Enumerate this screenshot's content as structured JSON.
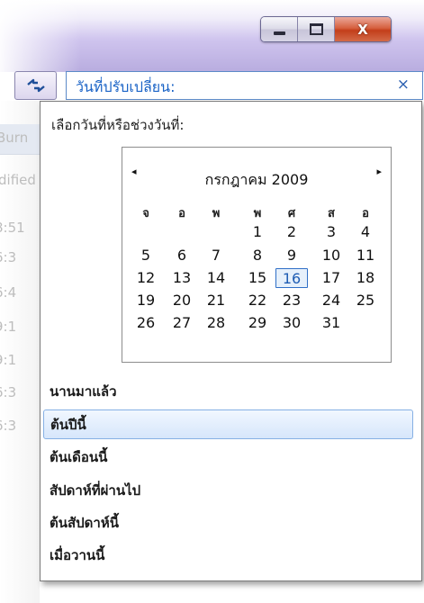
{
  "window": {
    "minimize_icon": "minimize-icon",
    "maximize_icon": "maximize-icon",
    "close_glyph": "X"
  },
  "search": {
    "nav_icon": "refresh-arrows-icon",
    "label": "วันที่ปรับเปลี่ยน:",
    "clear_glyph": "×"
  },
  "underlay": {
    "items": [
      "Burn",
      "dified",
      "8:51",
      "6:3",
      "6:4",
      "9:1",
      "9:1",
      "6:3",
      "6:3"
    ]
  },
  "panel": {
    "prompt": "เลือกวันที่หรือช่วงวันที่:",
    "calendar": {
      "prev_glyph": "◂",
      "next_glyph": "▸",
      "title": "กรกฎาคม 2009",
      "weekdays": [
        "จ",
        "อ",
        "พ",
        "พ",
        "ศ",
        "ส",
        "อ"
      ],
      "weeks": [
        [
          "",
          "",
          "",
          "1",
          "2",
          "3",
          "4"
        ],
        [
          "5",
          "6",
          "7",
          "8",
          "9",
          "10",
          "11"
        ],
        [
          "12",
          "13",
          "14",
          "15",
          "16",
          "17",
          "18"
        ],
        [
          "19",
          "20",
          "21",
          "22",
          "23",
          "24",
          "25"
        ],
        [
          "26",
          "27",
          "28",
          "29",
          "30",
          "31",
          ""
        ]
      ],
      "today": "16"
    },
    "presets": [
      "นานมาแล้ว",
      "ต้นปีนี้",
      "ต้นเดือนนี้",
      "สัปดาห์ที่ผ่านไป",
      "ต้นสัปดาห์นี้",
      "เมื่อวานนี้"
    ],
    "selected_preset": "ต้นปีนี้"
  },
  "colors": {
    "accent": "#1a63c6",
    "selection_border": "#86b0e4",
    "close_red": "#c33e1a"
  }
}
